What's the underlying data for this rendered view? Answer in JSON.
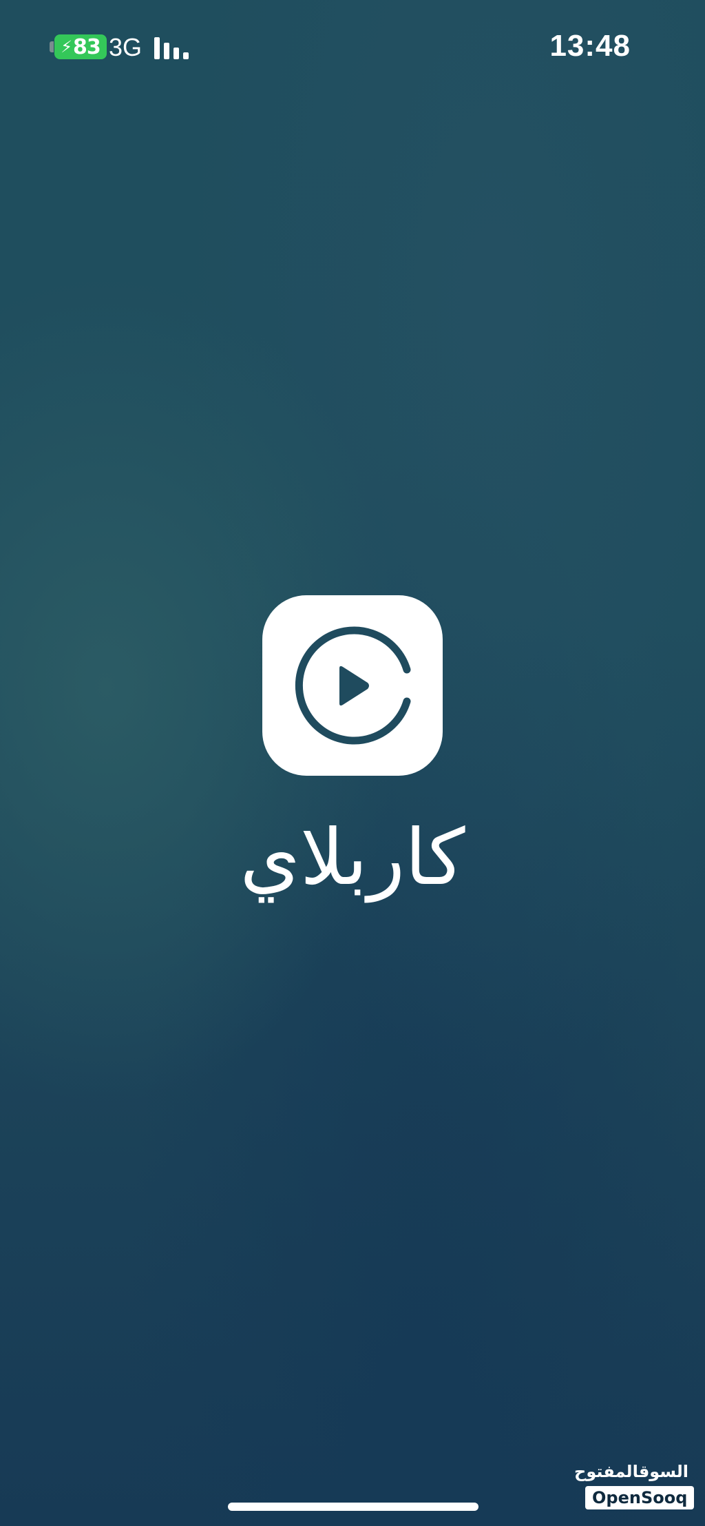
{
  "status_bar": {
    "battery_level": "83",
    "battery_color": "#34c759",
    "charging_icon": "bolt-icon",
    "network": "3G",
    "signal_icon": "signal-bars-icon",
    "time": "13:48"
  },
  "splash": {
    "app_icon": "play-circle-c-icon",
    "app_name": "كاربلاي",
    "icon_background": "#ffffff",
    "icon_foreground": "#1f4b5e"
  },
  "watermark": {
    "arabic": "السوقالمفتوح",
    "english": "OpenSooq"
  },
  "home_indicator_icon": "home-indicator"
}
